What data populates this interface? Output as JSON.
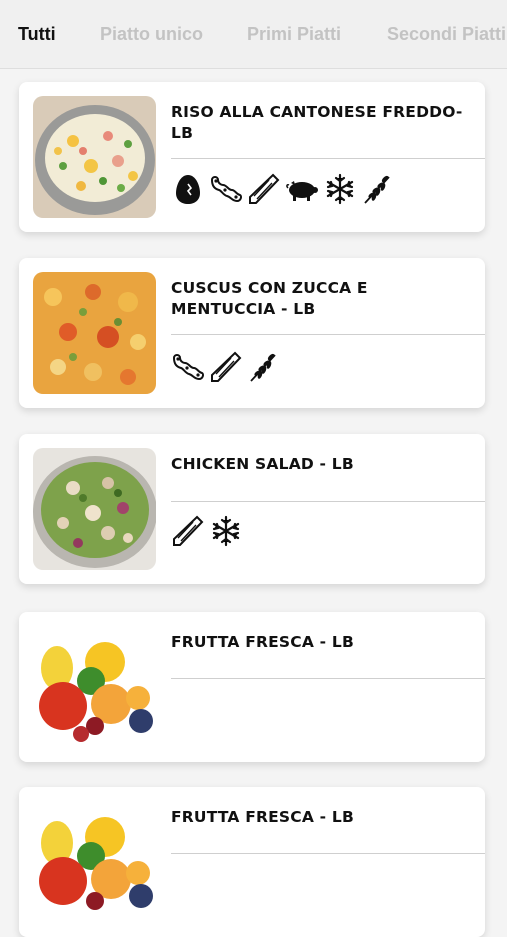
{
  "tabs": [
    {
      "label": "Tutti",
      "active": true
    },
    {
      "label": "Piatto unico",
      "active": false
    },
    {
      "label": "Primi Piatti",
      "active": false
    },
    {
      "label": "Secondi Piatti",
      "active": false
    }
  ],
  "dishes": [
    {
      "title": "RISO ALLA CANTONESE FREDDO-LB",
      "image": "rice-salad",
      "allergens": [
        "egg-icon",
        "soy-icon",
        "celery-icon",
        "pork-icon",
        "frozen-icon",
        "gluten-icon"
      ]
    },
    {
      "title": "CUSCUS CON ZUCCA E MENTUCCIA - LB",
      "image": "couscous",
      "allergens": [
        "soy-icon",
        "celery-icon",
        "gluten-icon"
      ]
    },
    {
      "title": "CHICKEN SALAD - LB",
      "image": "chicken-salad",
      "allergens": [
        "celery-icon",
        "frozen-icon"
      ]
    },
    {
      "title": "FRUTTA FRESCA - LB",
      "image": "fruit",
      "allergens": []
    },
    {
      "title": "FRUTTA FRESCA - LB",
      "image": "fruit",
      "allergens": []
    }
  ],
  "colors": {
    "active_tab": "#111111",
    "inactive_tab": "#c3c3c3",
    "card": "#ffffff",
    "background": "#f4f4f4"
  }
}
